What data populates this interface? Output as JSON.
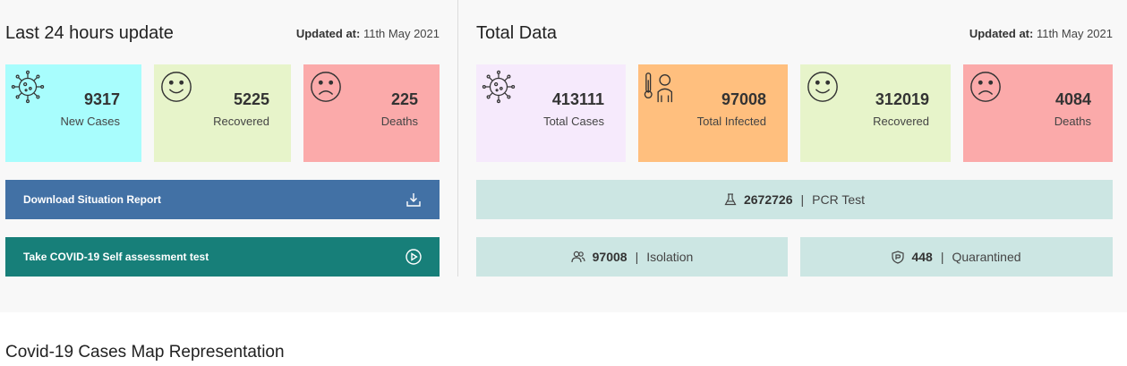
{
  "last24": {
    "title": "Last 24 hours update",
    "updated_label": "Updated at:",
    "updated_value": "11th May 2021",
    "cards": [
      {
        "value": "9317",
        "label": "New Cases",
        "icon": "virus-icon",
        "color": "#a8fdfd"
      },
      {
        "value": "5225",
        "label": "Recovered",
        "icon": "smile-icon",
        "color": "#e7f4ca"
      },
      {
        "value": "225",
        "label": "Deaths",
        "icon": "frown-icon",
        "color": "#fbaaaa"
      }
    ],
    "download_label": "Download Situation Report",
    "assessment_label": "Take COVID-19 Self assessment test"
  },
  "total": {
    "title": "Total Data",
    "updated_label": "Updated at:",
    "updated_value": "11th May 2021",
    "cards": [
      {
        "value": "413111",
        "label": "Total Cases",
        "icon": "virus-icon",
        "color": "#f6eafc"
      },
      {
        "value": "97008",
        "label": "Total Infected",
        "icon": "fever-icon",
        "color": "#ffbf7e"
      },
      {
        "value": "312019",
        "label": "Recovered",
        "icon": "smile-icon",
        "color": "#e7f4ca"
      },
      {
        "value": "4084",
        "label": "Deaths",
        "icon": "frown-icon",
        "color": "#fbaaaa"
      }
    ],
    "pcr": {
      "value": "2672726",
      "label": "PCR Test",
      "icon": "flask-icon"
    },
    "isolation": {
      "value": "97008",
      "label": "Isolation",
      "icon": "people-icon"
    },
    "quarantined": {
      "value": "448",
      "label": "Quarantined",
      "icon": "shield-icon"
    }
  },
  "map_title": "Covid-19 Cases Map Representation",
  "colors": {
    "download_bg": "#4271a5",
    "assessment_bg": "#177f79",
    "stat_bg": "#cce6e3"
  }
}
